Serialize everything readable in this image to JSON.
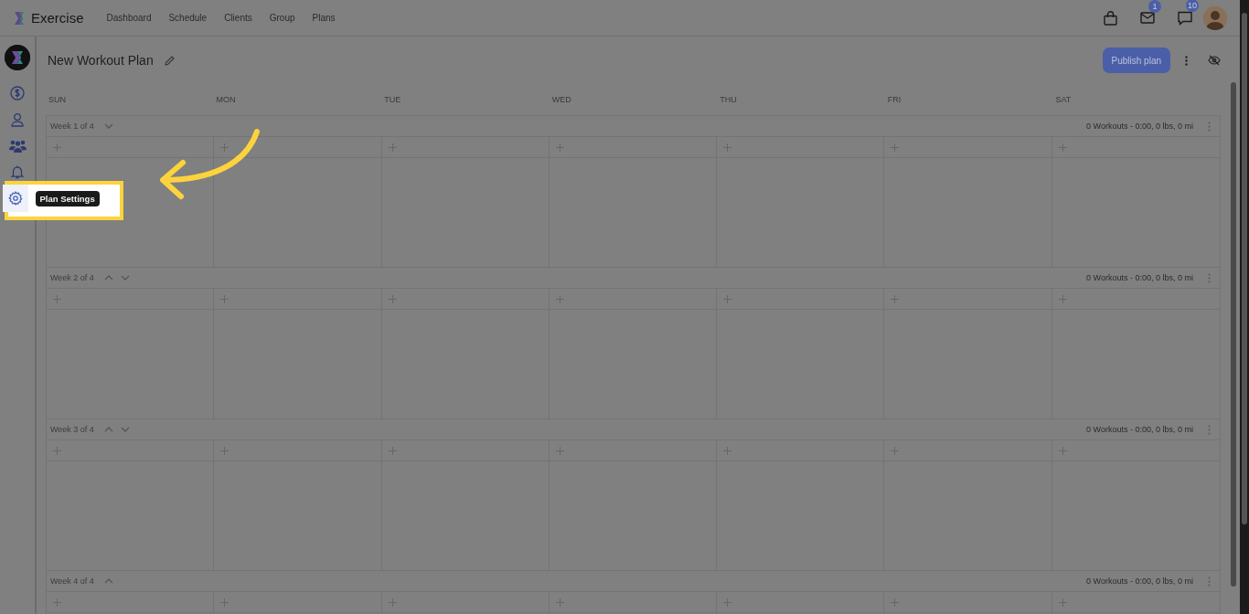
{
  "app": {
    "name": "Exercise"
  },
  "nav": [
    {
      "label": "Dashboard"
    },
    {
      "label": "Schedule"
    },
    {
      "label": "Clients"
    },
    {
      "label": "Group"
    },
    {
      "label": "Plans"
    }
  ],
  "header_icons": [
    {
      "kind": "bag"
    },
    {
      "kind": "mail",
      "badge": "1"
    },
    {
      "kind": "chat",
      "badge": "10"
    }
  ],
  "sidebar": {
    "items": [
      {
        "kind": "dollar",
        "selected": false
      },
      {
        "kind": "person",
        "selected": false
      },
      {
        "kind": "group",
        "selected": false
      },
      {
        "kind": "bell",
        "selected": false
      },
      {
        "kind": "gear",
        "selected": true,
        "tooltip": "Plan Settings"
      }
    ]
  },
  "plan": {
    "title": "New Workout Plan",
    "publish_button": "Publish plan"
  },
  "days": [
    "SUN",
    "MON",
    "TUE",
    "WED",
    "THU",
    "FRI",
    "SAT"
  ],
  "weeks": [
    {
      "label": "Week 1 of 4",
      "up": false,
      "down": true,
      "summary": "0 Workouts - 0:00, 0 lbs, 0 mi"
    },
    {
      "label": "Week 2 of 4",
      "up": true,
      "down": true,
      "summary": "0 Workouts - 0:00, 0 lbs, 0 mi"
    },
    {
      "label": "Week 3 of 4",
      "up": true,
      "down": true,
      "summary": "0 Workouts - 0:00, 0 lbs, 0 mi"
    },
    {
      "label": "Week 4 of 4",
      "up": true,
      "down": false,
      "summary": "0 Workouts - 0:00, 0 lbs, 0 mi"
    }
  ]
}
